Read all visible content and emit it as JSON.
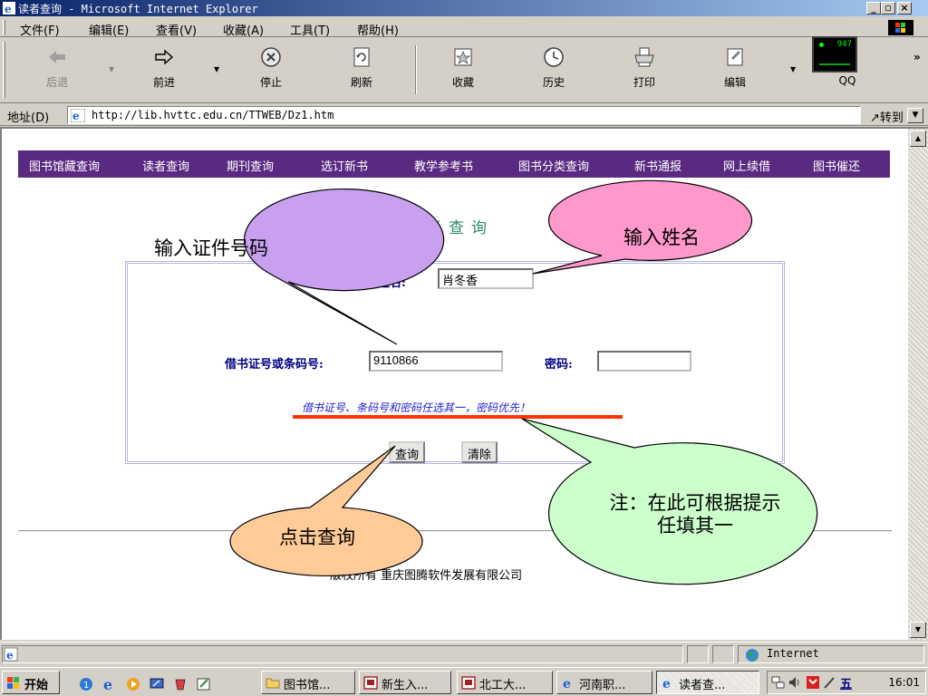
{
  "window": {
    "title": "读者查询 - Microsoft Internet Explorer",
    "controls": [
      "_",
      "▫",
      "×"
    ]
  },
  "menu": {
    "items": [
      "文件(F)",
      "编辑(E)",
      "查看(V)",
      "收藏(A)",
      "工具(T)",
      "帮助(H)"
    ]
  },
  "toolbar": {
    "back": "后退",
    "forward": "前进",
    "stop": "停止",
    "refresh": "刷新",
    "favorites": "收藏",
    "history": "历史",
    "print": "打印",
    "edit": "编辑",
    "qq": "QQ",
    "qq_monitor_value": "947",
    "more": "»",
    "icons": {
      "back": "back-arrow-icon",
      "forward": "forward-arrow-icon",
      "stop": "stop-icon",
      "refresh": "refresh-icon",
      "favorites": "favorites-icon",
      "history": "history-icon",
      "print": "printer-icon",
      "edit": "edit-icon"
    }
  },
  "address": {
    "label": "地址(D)",
    "url": "http://lib.hvttc.edu.cn/TTWEB/Dz1.htm",
    "go": "转到"
  },
  "nav": {
    "items": [
      "图书馆藏查询",
      "读者查询",
      "期刊查询",
      "选订新书",
      "教学参考书",
      "图书分类查询",
      "新书通报",
      "网上续借",
      "图书催还"
    ]
  },
  "page": {
    "title": "读者查询",
    "form": {
      "name_label": "姓名:",
      "name_value": "肖冬香",
      "card_label": "借书证号或条码号:",
      "card_value": "9110866",
      "password_label": "密码:",
      "password_value": "",
      "hint": "借书证号、条码号和密码任选其一，密码优先！",
      "query_button": "查询",
      "clear_button": "清除"
    },
    "copyright": "版权所有 重庆图腾软件发展有限公司"
  },
  "callouts": {
    "card": "输入证件号码",
    "name": "输入姓名",
    "click": "点击查询",
    "note": "注：在此可根据提示任填其一",
    "colors": {
      "card": "#c9a0f0",
      "name": "#ff99cc",
      "click": "#ffcc99",
      "note": "#ccffcc"
    }
  },
  "status": {
    "zone": "Internet"
  },
  "taskbar": {
    "start": "开始",
    "tasks": [
      "图书馆...",
      "新生入...",
      "北工大...",
      "河南职...",
      "读者查..."
    ],
    "active_task": 4,
    "clock": "16:01",
    "tray_ime": "五"
  }
}
